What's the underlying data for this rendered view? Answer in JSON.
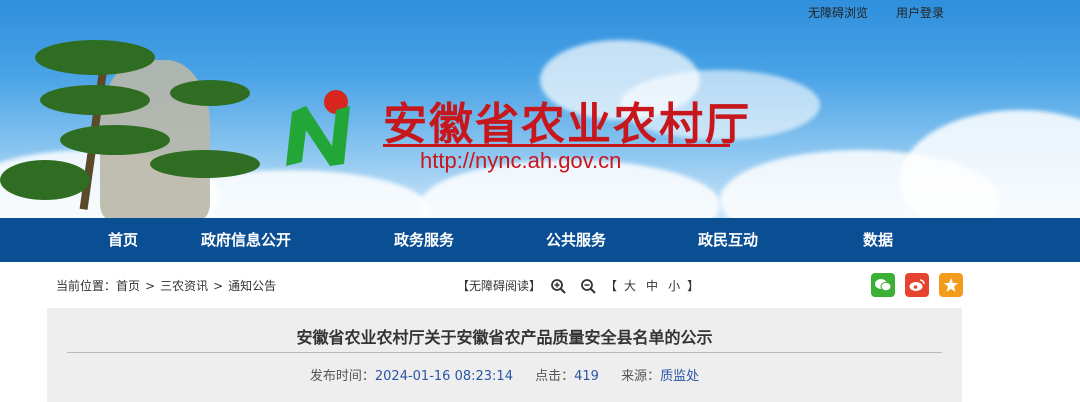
{
  "toplinks": {
    "accessible": "无障碍浏览",
    "login": "用户登录"
  },
  "brand": {
    "title": "安徽省农业农村厅",
    "url": "http://nync.ah.gov.cn",
    "accent": "#c8161d",
    "nav_bg": "#0a4e93"
  },
  "nav": {
    "items": [
      "首页",
      "政府信息公开",
      "政务服务",
      "公共服务",
      "政民互动",
      "数据"
    ]
  },
  "breadcrumb": {
    "label": "当前位置：",
    "items": [
      "首页",
      "三农资讯",
      "通知公告"
    ],
    "sep": ">"
  },
  "tools": {
    "accessible_read": "【无障碍阅读】",
    "size_open": "【",
    "size_big": "大",
    "size_mid": "中",
    "size_small": "小",
    "size_close": "】"
  },
  "share": {
    "icons": [
      "wechat-icon",
      "weibo-icon",
      "favorite-icon"
    ]
  },
  "article": {
    "title": "安徽省农业农村厅关于安徽省农产品质量安全县名单的公示",
    "publish_label": "发布时间：",
    "publish_time": "2024-01-16 08:23:14",
    "clicks_label": "点击：",
    "clicks": "419",
    "source_label": "来源：",
    "source": "质监处"
  }
}
